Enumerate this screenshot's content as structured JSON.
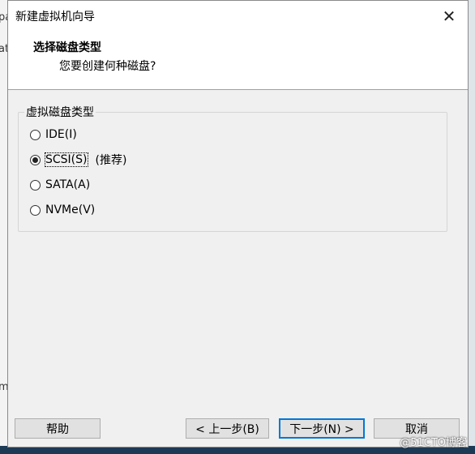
{
  "background": {
    "left_fragment_1": "pa",
    "left_fragment_2": "at",
    "left_fragment_3": "m"
  },
  "window": {
    "title": "新建虚拟机向导",
    "close_glyph": "✕"
  },
  "header": {
    "title": "选择磁盘类型",
    "subtitle": "您要创建何种磁盘?"
  },
  "group": {
    "label": "虚拟磁盘类型",
    "options": [
      {
        "label": "IDE(I)",
        "checked": false
      },
      {
        "label": "SCSI(S)",
        "checked": true,
        "note": "(推荐)"
      },
      {
        "label": "SATA(A)",
        "checked": false
      },
      {
        "label": "NVMe(V)",
        "checked": false
      }
    ]
  },
  "buttons": {
    "help": "帮助",
    "back": "< 上一步(B)",
    "next": "下一步(N) >",
    "cancel": "取消"
  },
  "watermark": "@51CTO博客",
  "colors": {
    "accent": "#0078d7",
    "dialog_bg": "#f0f0f0"
  }
}
